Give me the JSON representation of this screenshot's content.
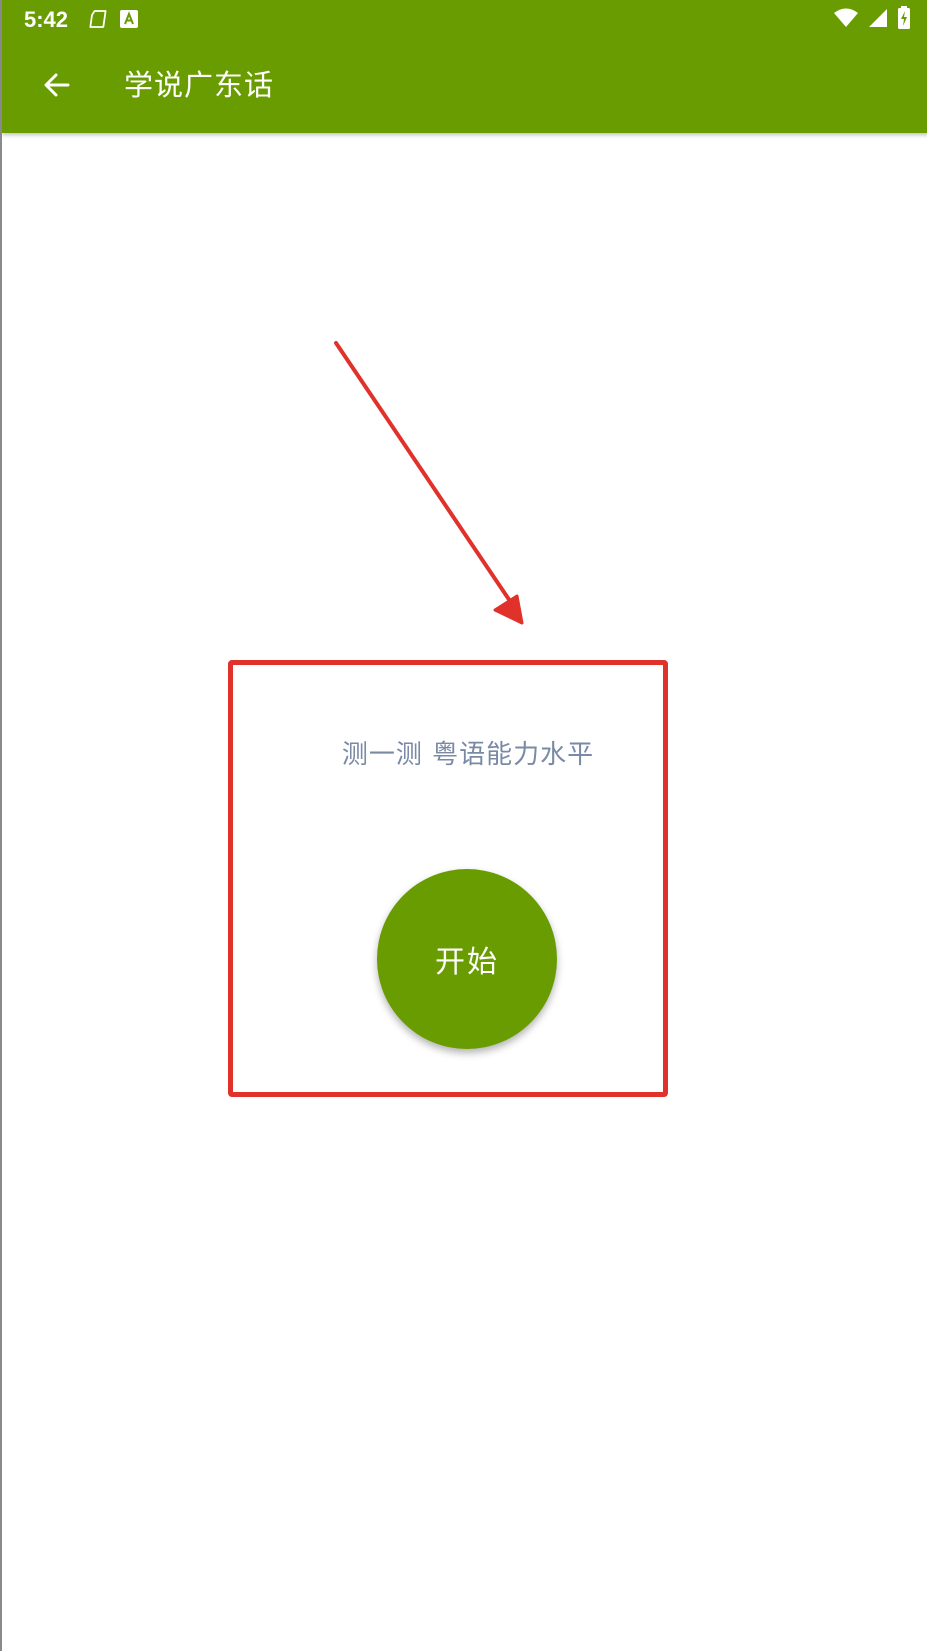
{
  "status_bar": {
    "time": "5:42",
    "left_icons": [
      "storage-icon",
      "keyboard-a-icon"
    ],
    "right_icons": [
      "wifi-icon",
      "signal-icon",
      "battery-charging-icon"
    ]
  },
  "app_bar": {
    "title": "学说广东话",
    "back_icon": "arrow-left-icon",
    "background_color": "#699c00"
  },
  "main": {
    "test_label": "测一测 粤语能力水平",
    "start_button_label": "开始",
    "start_button_color": "#699c00"
  },
  "annotation": {
    "highlight_color": "#e0312a"
  }
}
